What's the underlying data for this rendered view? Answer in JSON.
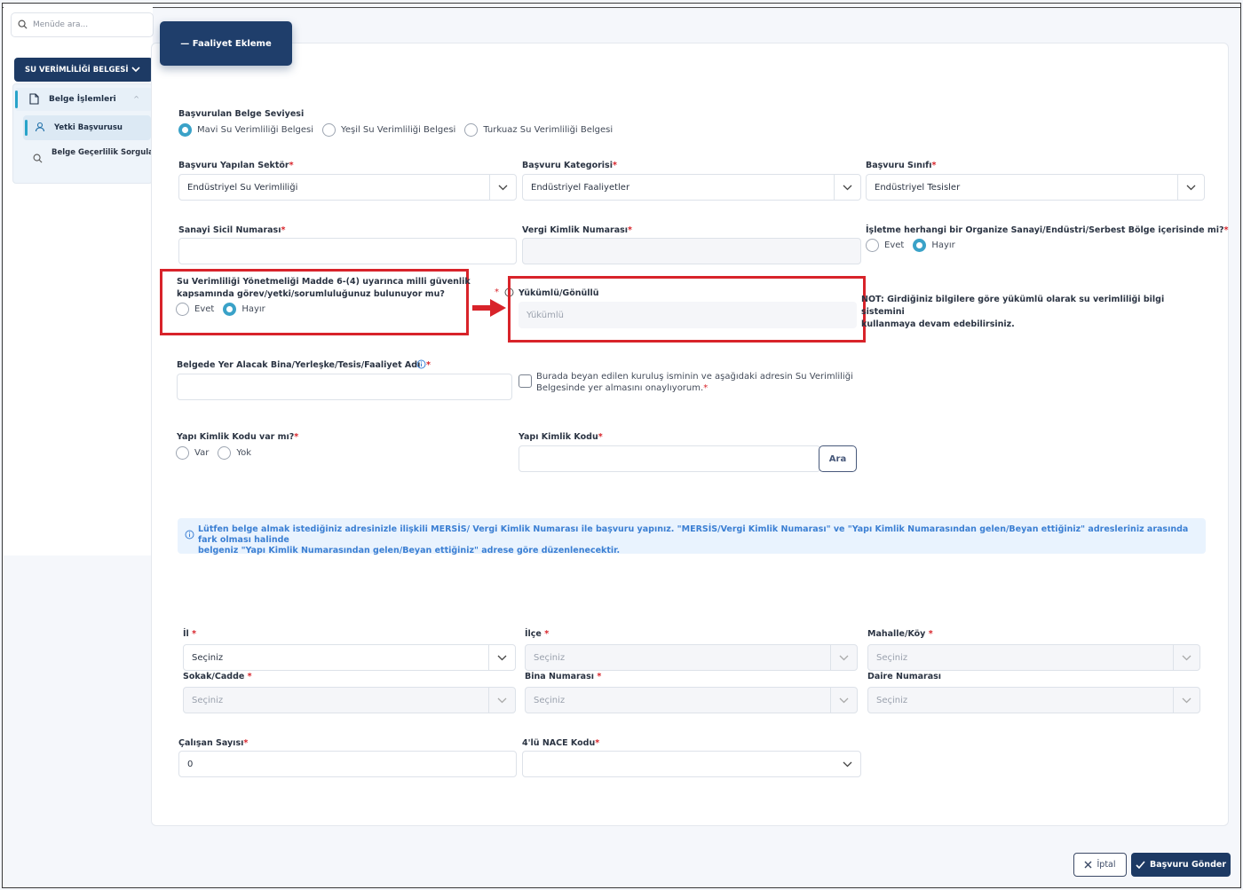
{
  "sidebar": {
    "search_placeholder": "Menüde ara...",
    "certificate_label": "SU VERİMLİLİĞİ BELGESİ",
    "group_label": "Belge İşlemleri",
    "active_item": "Yetki Başvurusu",
    "second_item": "Belge Geçerlilik Sorgulama"
  },
  "header": {
    "tab_label": "— Faaliyet Ekleme"
  },
  "form": {
    "level": {
      "label": "Başvurulan Belge Seviyesi",
      "options": [
        "Mavi Su Verimliliği Belgesi",
        "Yeşil Su Verimliliği Belgesi",
        "Turkuaz Su Verimliliği Belgesi"
      ],
      "selected": 0
    },
    "sector": {
      "label": "Başvuru Yapılan Sektör",
      "value": "Endüstriyel Su Verimliliği"
    },
    "category": {
      "label": "Başvuru Kategorisi",
      "value": "Endüstriyel Faaliyetler"
    },
    "class": {
      "label": "Başvuru Sınıfı",
      "value": "Endüstriyel Tesisler"
    },
    "registry": {
      "label": "Sanayi Sicil Numarası",
      "value": ""
    },
    "tax": {
      "label": "Vergi Kimlik Numarası",
      "value": ""
    },
    "zone": {
      "label": "İşletme herhangi bir Organize Sanayi/Endüstri/Serbest Bölge içerisinde mi?",
      "yes": "Evet",
      "no": "Hayır",
      "selected": "no"
    },
    "security": {
      "label_line1": "Su Verimliliği Yönetmeliği Madde 6-(4) uyarınca milli güvenlik",
      "label_line2": "kapsamında görev/yetki/sorumluluğunuz bulunuyor mu?",
      "yes": "Evet",
      "no": "Hayır",
      "selected": "no"
    },
    "obligation": {
      "label": "Yükümlü/Gönüllü",
      "placeholder": "Yükümlü"
    },
    "note_line1": "NOT: Girdiğiniz bilgilere göre yükümlü olarak su verimliliği bilgi sistemini",
    "note_line2": "kullanmaya devam edebilirsiniz.",
    "facility": {
      "label": "Belgede Yer Alacak Bina/Yerleşke/Tesis/Faaliyet Adı",
      "value": ""
    },
    "consent_line1": "Burada beyan edilen kuruluş isminin ve aşağıdaki adresin Su Verimliliği",
    "consent_line2": "Belgesinde yer almasını onaylıyorum.",
    "building_code_q": {
      "label": "Yapı Kimlik Kodu var mı?",
      "yes": "Var",
      "no": "Yok"
    },
    "building_code": {
      "label": "Yapı Kimlik Kodu",
      "value": "",
      "search_button": "Ara"
    },
    "info_text_line1": "Lütfen belge almak istediğiniz adresinizle ilişkili MERSİS/ Vergi Kimlik Numarası ile başvuru yapınız. \"MERSİS/Vergi Kimlik Numarası\" ve \"Yapı Kimlik Numarasından gelen/Beyan ettiğiniz\" adresleriniz arasında fark olması halinde",
    "info_text_line2": "belgeniz \"Yapı Kimlik Numarasından gelen/Beyan ettiğiniz\" adrese göre düzenlenecektir.",
    "city": {
      "label": "İl",
      "value": "Seçiniz"
    },
    "district": {
      "label": "İlçe",
      "value": "Seçiniz"
    },
    "neighborhood": {
      "label": "Mahalle/Köy",
      "value": "Seçiniz"
    },
    "street": {
      "label": "Sokak/Cadde",
      "value": "Seçiniz"
    },
    "building_no": {
      "label": "Bina Numarası",
      "value": "Seçiniz"
    },
    "apartment_no": {
      "label": "Daire Numarası",
      "value": "Seçiniz"
    },
    "employees": {
      "label": "Çalışan Sayısı",
      "value": "0"
    },
    "nace": {
      "label": "4'lü NACE Kodu",
      "value": ""
    }
  },
  "footer": {
    "cancel_label": "İptal",
    "submit_label": "Başvuru Gönder"
  },
  "colors": {
    "primary": "#1d3a64",
    "accent": "#3aa2c8",
    "highlight": "#d8232a",
    "info": "#3b7fd3"
  }
}
